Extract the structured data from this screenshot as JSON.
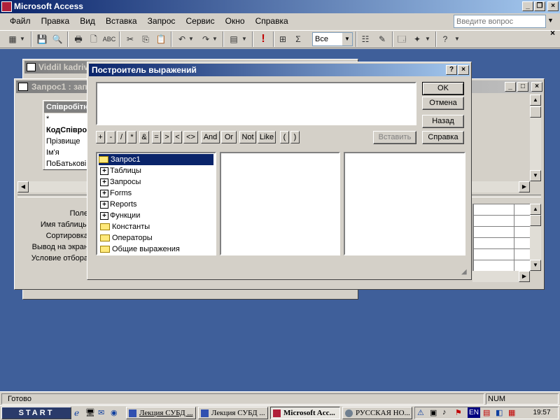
{
  "app": {
    "title": "Microsoft Access"
  },
  "menu": [
    "Файл",
    "Правка",
    "Вид",
    "Вставка",
    "Запрос",
    "Сервис",
    "Окно",
    "Справка"
  ],
  "help_box": {
    "placeholder": "Введите вопрос"
  },
  "toolbar": {
    "top_values_value": "Все"
  },
  "table_window": {
    "title": "Viddil kadriv"
  },
  "query_window": {
    "title": "Запрос1 : запрос на выборку",
    "table_title": "Співробітники",
    "fields": [
      "*",
      "КодСпівробітника",
      "Прізвище",
      "Ім'я",
      "ПоБатькові"
    ],
    "grid_labels": [
      "Поле:",
      "Имя таблицы:",
      "Сортировка:",
      "Вывод на экран:",
      "Условие отбора:"
    ]
  },
  "dialog": {
    "title": "Построитель выражений",
    "ok": "OK",
    "cancel": "Отмена",
    "back": "Назад",
    "help": "Справка",
    "paste": "Вставить",
    "operators": [
      "+",
      "-",
      "/",
      "*",
      "&",
      "=",
      ">",
      "<",
      "<>",
      "And",
      "Or",
      "Not",
      "Like",
      "(",
      ")"
    ],
    "tree": [
      {
        "label": "Запрос1",
        "expandable": false,
        "selected": true,
        "open": true
      },
      {
        "label": "Таблицы",
        "expandable": true
      },
      {
        "label": "Запросы",
        "expandable": true
      },
      {
        "label": "Forms",
        "expandable": true
      },
      {
        "label": "Reports",
        "expandable": true
      },
      {
        "label": "Функции",
        "expandable": true
      },
      {
        "label": "Константы",
        "expandable": false
      },
      {
        "label": "Операторы",
        "expandable": false
      },
      {
        "label": "Общие выражения",
        "expandable": false
      }
    ]
  },
  "status": {
    "text": "Готово",
    "num": "NUM"
  },
  "taskbar": {
    "start": "START",
    "buttons": [
      "Лекция СУБД ...",
      "Лекция СУБД ...",
      "Microsoft Acc...",
      "РУССКАЯ НО..."
    ],
    "lang": "EN",
    "clock": "19:57"
  },
  "colors": {
    "desktop": "#3a6ea5",
    "mdi": "#3f5f9a",
    "title_active": "#0a246a",
    "title_inactive": "#808080",
    "selection": "#0a246a"
  }
}
